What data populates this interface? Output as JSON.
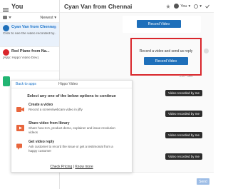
{
  "sidebar": {
    "title": "You",
    "filter_sort": "Newest",
    "conversations": [
      {
        "name": "Cyan Van from Chenna...",
        "preview": "Click to see the video recorded by...",
        "active": true,
        "avatar_color": "#1e6fba"
      },
      {
        "name": "Red Plane from Na...",
        "preview": "[App: Hippo Video Dev]",
        "active": false,
        "avatar_color": "#d9262b"
      }
    ]
  },
  "chat": {
    "title": "Cyan Van from Chennai",
    "you_label": "You",
    "record_label": "Record Video",
    "prompt_text": "Record a video and send us reply",
    "timestamp": "21d · Sent",
    "pill_label": "Video recorded by me",
    "send_label": "Send"
  },
  "popover": {
    "back_label": "Back to apps",
    "tab_label": "Hippo Video",
    "subtitle": "Select any one of the below options to continue",
    "options": [
      {
        "title": "Create a video",
        "desc": "Record a screen/webcam video in jiffy",
        "icon": "camera-icon"
      },
      {
        "title": "Share video from library",
        "desc": "Share how-to's, product demo, explainer and issue resolution videos",
        "icon": "library-icon"
      },
      {
        "title": "Get video reply",
        "desc": "Ask customer to record the issue or get a testimonial from a happy customer",
        "icon": "video-reply-icon"
      }
    ],
    "footer_link1": "Check Pricing",
    "footer_sep": "|",
    "footer_link2": "Know more"
  },
  "colors": {
    "accent": "#1e6fba",
    "highlight": "#d9262b",
    "orange": "#e8663d",
    "green": "#22b573"
  }
}
